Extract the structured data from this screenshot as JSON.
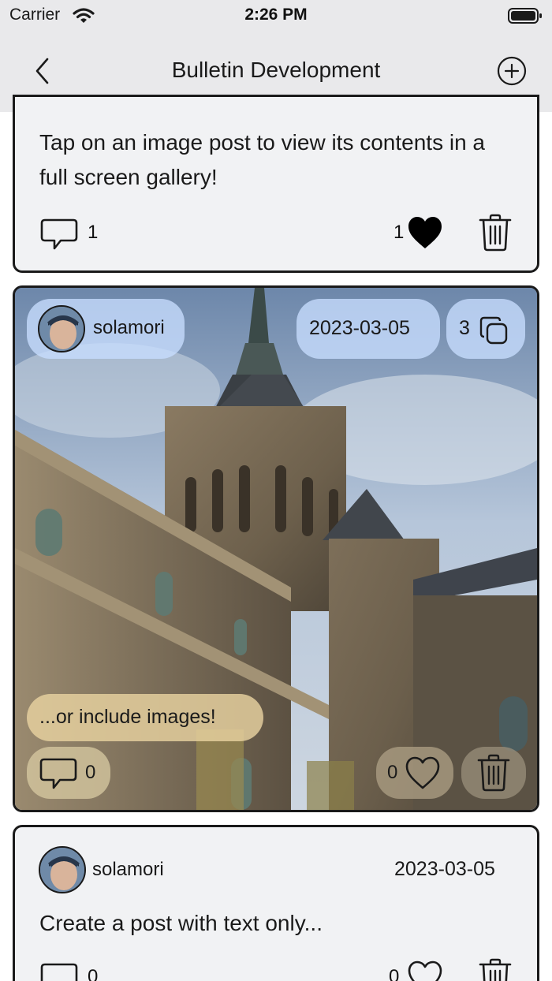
{
  "status_bar": {
    "carrier": "Carrier",
    "time": "2:26 PM"
  },
  "nav": {
    "title": "Bulletin Development"
  },
  "posts": [
    {
      "text": "Tap on an image post to view its contents in a full screen gallery!",
      "comments": "1",
      "likes": "1",
      "liked": true
    },
    {
      "username": "solamori",
      "date": "2023-03-05",
      "image_count": "3",
      "caption": "...or include images!",
      "comments": "0",
      "likes": "0",
      "liked": false
    },
    {
      "username": "solamori",
      "date": "2023-03-05",
      "text": "Create a post with text only...",
      "comments": "0",
      "likes": "0",
      "liked": false
    }
  ],
  "icons": {
    "back": "chevron-left-icon",
    "add": "plus-circle-icon",
    "comment": "speech-bubble-icon",
    "heart": "heart-icon",
    "trash": "trash-icon",
    "gallery": "stacked-squares-icon"
  }
}
